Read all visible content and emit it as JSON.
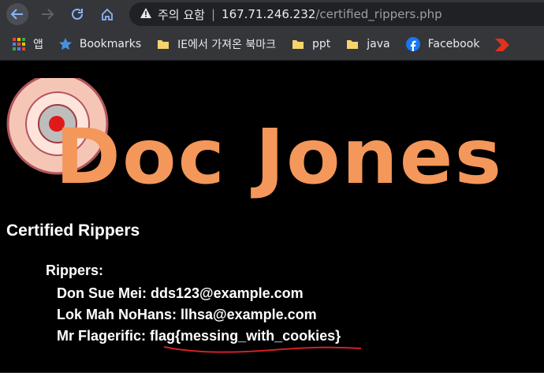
{
  "browser": {
    "security_label": "주의 요함",
    "url_host": "167.71.246.232",
    "url_path": "/certified_rippers.php",
    "bookmarks": [
      {
        "label": "앱",
        "icon": "apps-grid-icon"
      },
      {
        "label": "Bookmarks",
        "icon": "star-icon"
      },
      {
        "label": "IE에서 가져온 북마크",
        "icon": "folder-icon"
      },
      {
        "label": "ppt",
        "icon": "folder-icon"
      },
      {
        "label": "java",
        "icon": "folder-icon"
      },
      {
        "label": "Facebook",
        "icon": "facebook-icon"
      }
    ]
  },
  "page": {
    "logo_text": "Doc Jones",
    "heading": "Certified Rippers",
    "rippers_label": "Rippers:",
    "rippers": [
      {
        "name": "Don Sue Mei",
        "value": "dds123@example.com"
      },
      {
        "name": "Lok Mah NoHans",
        "value": "llhsa@example.com"
      },
      {
        "name": "Mr Flagerific",
        "value": "flag{messing_with_cookies}"
      }
    ]
  },
  "colors": {
    "logo_orange": "#f4975a",
    "annotation_red": "#d42020",
    "chrome_bg": "#35363a"
  }
}
